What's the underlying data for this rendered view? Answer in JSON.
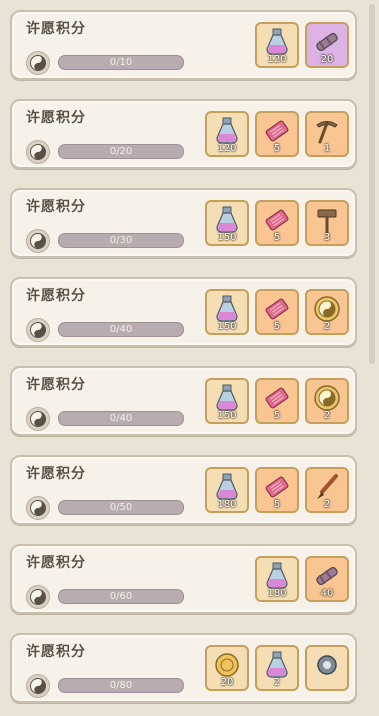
{
  "rows": [
    {
      "title": "许愿积分",
      "progress": "0/10",
      "fill": 0,
      "rewards": [
        {
          "icon": "potion-icon",
          "bg": "#f5deb3",
          "qty": "120"
        },
        {
          "icon": "cannon-icon",
          "bg": "#dcb3e4",
          "qty": "20"
        }
      ]
    },
    {
      "title": "许愿积分",
      "progress": "0/20",
      "fill": 0,
      "rewards": [
        {
          "icon": "potion-icon",
          "bg": "#f5deb3",
          "qty": "120"
        },
        {
          "icon": "ticket-icon",
          "bg": "#f9c592",
          "qty": "5"
        },
        {
          "icon": "pickaxe-icon",
          "bg": "#f9c592",
          "qty": "1"
        }
      ]
    },
    {
      "title": "许愿积分",
      "progress": "0/30",
      "fill": 0,
      "rewards": [
        {
          "icon": "potion-icon",
          "bg": "#f5deb3",
          "qty": "150"
        },
        {
          "icon": "ticket-icon",
          "bg": "#f9c592",
          "qty": "5"
        },
        {
          "icon": "hammer-icon",
          "bg": "#f9c592",
          "qty": "3"
        }
      ]
    },
    {
      "title": "许愿积分",
      "progress": "0/40",
      "fill": 0,
      "rewards": [
        {
          "icon": "potion-icon",
          "bg": "#f5deb3",
          "qty": "150"
        },
        {
          "icon": "ticket-icon",
          "bg": "#f9c592",
          "qty": "5"
        },
        {
          "icon": "yinyang-coin-icon",
          "bg": "#f9c592",
          "qty": "2"
        }
      ]
    },
    {
      "title": "许愿积分",
      "progress": "0/40",
      "fill": 0,
      "rewards": [
        {
          "icon": "potion-icon",
          "bg": "#f5deb3",
          "qty": "150"
        },
        {
          "icon": "ticket-icon",
          "bg": "#f9c592",
          "qty": "5"
        },
        {
          "icon": "yinyang-coin-icon",
          "bg": "#f9c592",
          "qty": "2"
        }
      ]
    },
    {
      "title": "许愿积分",
      "progress": "0/50",
      "fill": 0,
      "rewards": [
        {
          "icon": "potion-icon",
          "bg": "#f5deb3",
          "qty": "180"
        },
        {
          "icon": "ticket-icon",
          "bg": "#f9c592",
          "qty": "5"
        },
        {
          "icon": "brush-icon",
          "bg": "#f9c592",
          "qty": "2"
        }
      ]
    },
    {
      "title": "许愿积分",
      "progress": "0/60",
      "fill": 0,
      "rewards": [
        {
          "icon": "potion-icon",
          "bg": "#f5deb3",
          "qty": "180"
        },
        {
          "icon": "cannon-icon",
          "bg": "#f9c592",
          "qty": "40"
        }
      ]
    },
    {
      "title": "许愿积分",
      "progress": "0/80",
      "fill": 0,
      "rewards": [
        {
          "icon": "coin-icon",
          "bg": "#f5deb3",
          "qty": "20"
        },
        {
          "icon": "potion-icon",
          "bg": "#f5deb3",
          "qty": "2"
        },
        {
          "icon": "gear-icon",
          "bg": "#f5deb3",
          "qty": ""
        }
      ]
    }
  ]
}
